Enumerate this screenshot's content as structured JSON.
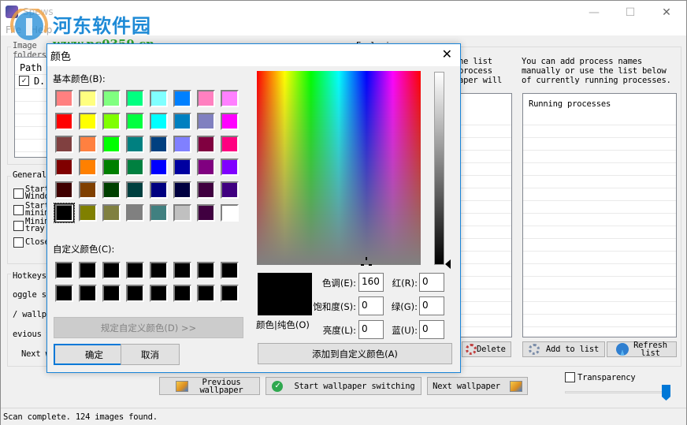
{
  "window": {
    "title": "Spews",
    "minimize_glyph": "—",
    "maximize_glyph": "☐",
    "close_glyph": "✕"
  },
  "menu": {
    "items": [
      "File",
      "Help"
    ]
  },
  "watermark": {
    "brand": "河东软件园",
    "url": "www.pc0359.cn"
  },
  "image_folders": {
    "group_label": "Image folders",
    "column_header": "Path",
    "rows": [
      {
        "checked": true,
        "path": "D."
      }
    ]
  },
  "general": {
    "group_label": "General",
    "options": [
      {
        "label_line1": "Start",
        "label_line2": "Windows",
        "checked": false
      },
      {
        "label_line1": "Start",
        "label_line2": "minim",
        "checked": false
      },
      {
        "label_line1": "Minim",
        "label_line2": "tray",
        "checked": false
      },
      {
        "label_line1": "Close",
        "label_line2": "",
        "checked": false
      }
    ]
  },
  "hotkeys": {
    "group_label": "Hotkeys",
    "rows": [
      "oggle st",
      "/ wallpa",
      "evious w",
      "Next w"
    ]
  },
  "exclusions": {
    "group_label": "Exclusions",
    "left_desc": [
      "he list",
      "process",
      "aper will"
    ],
    "right_desc": [
      "You can add process names",
      "manually or use the list below",
      "of currently running processes."
    ],
    "running_header": "Running processes",
    "delete_label": "Delete",
    "add_label": "Add to list",
    "refresh_label_1": "Refresh",
    "refresh_label_2": "list"
  },
  "bottom": {
    "prev_label_1": "Previous",
    "prev_label_2": "wallpaper",
    "start_label": "Start wallpaper switching",
    "next_label": "Next wallpaper",
    "transparency_label": "Transparency",
    "transparency_checked": false,
    "transparency_value": 1.0
  },
  "status": {
    "text": "Scan complete.  124 images found."
  },
  "color_dialog": {
    "title": "颜色",
    "close_glyph": "✕",
    "basic_label": "基本颜色(B):",
    "custom_label": "自定义颜色(C):",
    "basic_colors": [
      [
        "#ff8080",
        "#ffff80",
        "#80ff80",
        "#00ff80",
        "#80ffff",
        "#0080ff",
        "#ff80c0",
        "#ff80ff"
      ],
      [
        "#ff0000",
        "#ffff00",
        "#80ff00",
        "#00ff40",
        "#00ffff",
        "#0080c0",
        "#8080c0",
        "#ff00ff"
      ],
      [
        "#804040",
        "#ff8040",
        "#00ff00",
        "#008080",
        "#004080",
        "#8080ff",
        "#800040",
        "#ff0080"
      ],
      [
        "#800000",
        "#ff8000",
        "#008000",
        "#008040",
        "#0000ff",
        "#0000a0",
        "#800080",
        "#8000ff"
      ],
      [
        "#400000",
        "#804000",
        "#004000",
        "#004040",
        "#000080",
        "#000040",
        "#400040",
        "#400080"
      ],
      [
        "#000000",
        "#808000",
        "#808040",
        "#808080",
        "#408080",
        "#c0c0c0",
        "#400040",
        "#ffffff"
      ]
    ],
    "selected_basic": [
      5,
      0
    ],
    "custom_colors": [
      [
        "#000000",
        "#000000",
        "#000000",
        "#000000",
        "#000000",
        "#000000",
        "#000000",
        "#000000"
      ],
      [
        "#000000",
        "#000000",
        "#000000",
        "#000000",
        "#000000",
        "#000000",
        "#000000",
        "#000000"
      ]
    ],
    "define_custom_label": "规定自定义颜色(D) >>",
    "ok_label": "确定",
    "cancel_label": "取消",
    "preview_label": "颜色|纯色(O)",
    "hue_label": "色调(E):",
    "hue_value": "160",
    "sat_label": "饱和度(S):",
    "sat_value": "0",
    "lum_label": "亮度(L):",
    "lum_value": "0",
    "red_label": "红(R):",
    "red_value": "0",
    "green_label": "绿(G):",
    "green_value": "0",
    "blue_label": "蓝(U):",
    "blue_value": "0",
    "add_custom_label": "添加到自定义颜色(A)",
    "preview_color": "#000000"
  }
}
